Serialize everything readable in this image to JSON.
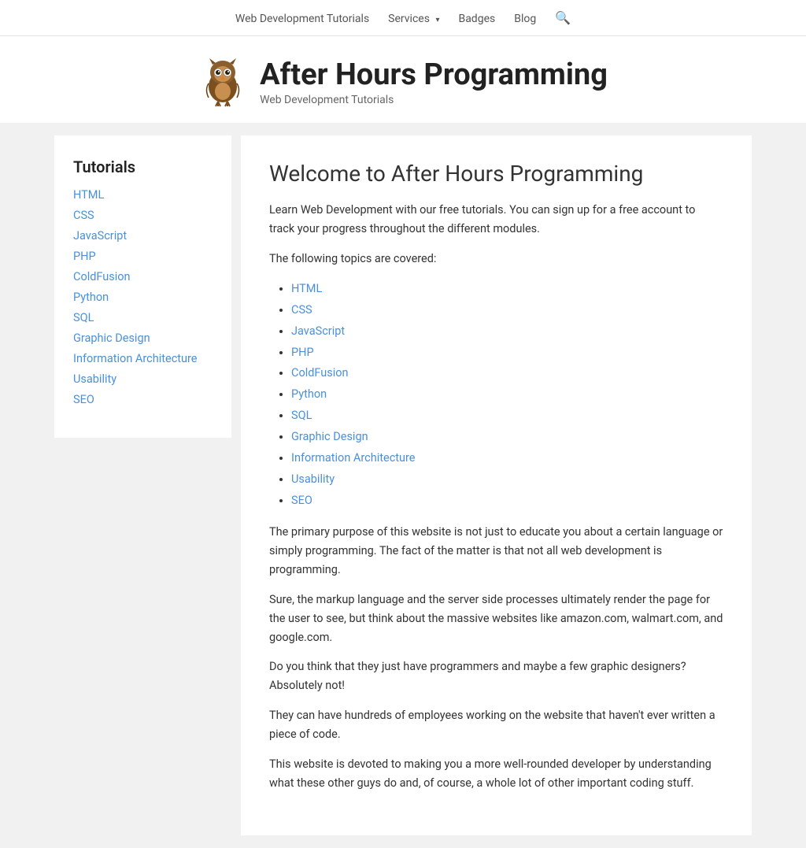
{
  "nav": {
    "items": [
      {
        "label": "Web Development Tutorials",
        "href": "#"
      },
      {
        "label": "Services",
        "href": "#",
        "hasArrow": true
      },
      {
        "label": "Badges",
        "href": "#"
      },
      {
        "label": "Blog",
        "href": "#"
      }
    ]
  },
  "header": {
    "site_title": "After Hours Programming",
    "site_tagline": "Web Development Tutorials"
  },
  "sidebar": {
    "heading": "Tutorials",
    "links": [
      "HTML",
      "CSS",
      "JavaScript",
      "PHP",
      "ColdFusion",
      "Python",
      "SQL",
      "Graphic Design",
      "Information Architecture",
      "Usability",
      "SEO"
    ]
  },
  "main": {
    "heading": "Welcome to After Hours Programming",
    "intro1": "Learn Web Development with our free tutorials. You can sign up for a free account to track your progress throughout the different modules.",
    "intro2": "The following topics are covered:",
    "topics": [
      "HTML",
      "CSS",
      "JavaScript",
      "PHP",
      "ColdFusion",
      "Python",
      "SQL",
      "Graphic Design",
      "Information Architecture",
      "Usability",
      "SEO"
    ],
    "para1": "The primary purpose of this website is not just to educate you about a certain language or simply programming. The fact of the matter is that not all web development is programming.",
    "para2": "Sure, the markup language and the server side processes ultimately render the page for the user to see, but think about the massive websites like amazon.com, walmart.com, and google.com.",
    "para3": "Do you think that they just have programmers and maybe a few graphic designers? Absolutely not!",
    "para4": "They can have hundreds of employees working on the website that haven't ever written a piece of code.",
    "para5": "This website is devoted to making you a more well-rounded developer by understanding what these other guys do and, of course, a whole lot of other important coding stuff."
  }
}
